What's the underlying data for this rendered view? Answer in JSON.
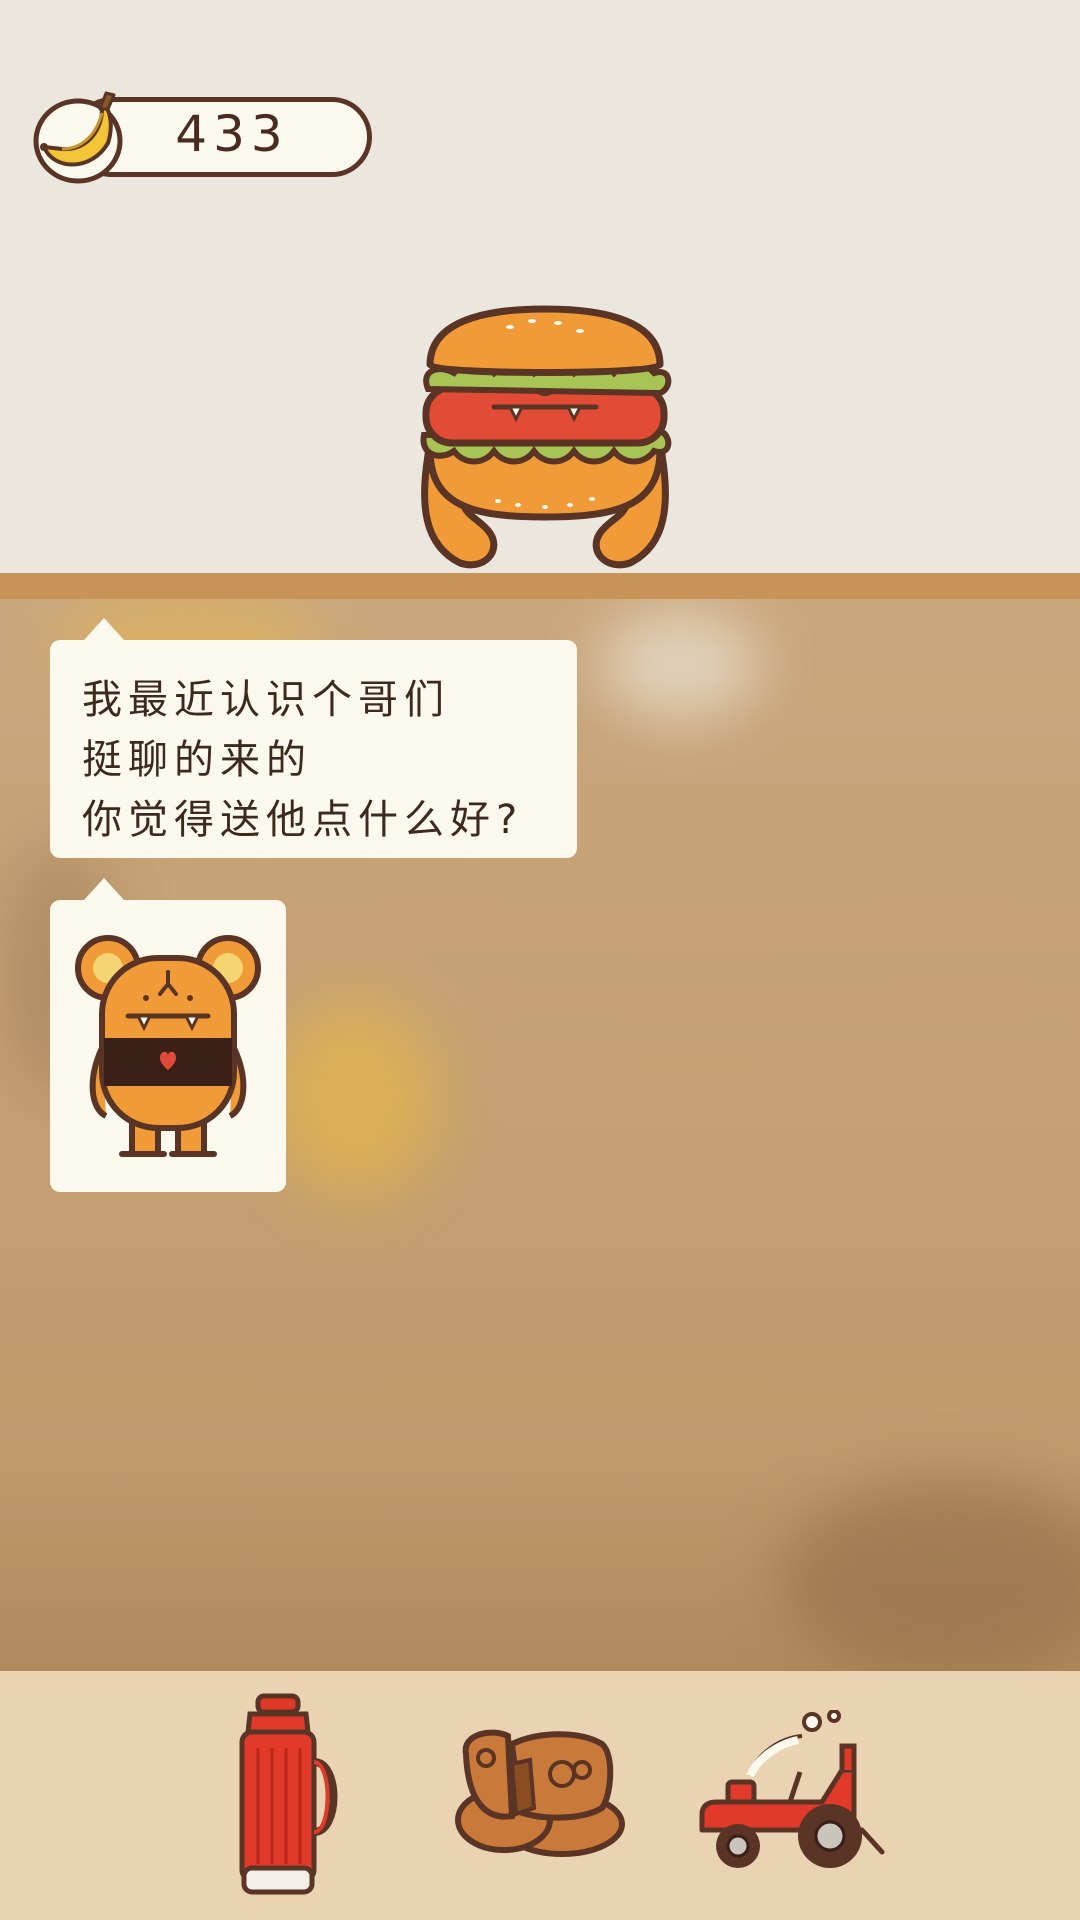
{
  "hud": {
    "banana_count": "433",
    "banana_icon": "banana-icon"
  },
  "character": {
    "icon": "burger-monster-icon"
  },
  "dialog": {
    "lines": [
      "我最近认识个哥们",
      "挺聊的来的",
      "你觉得送他点什么好?"
    ],
    "image_icon": "orange-bear-monster-icon"
  },
  "gift_options": [
    {
      "icon": "thermos-flask-icon"
    },
    {
      "icon": "mooncakes-icon"
    },
    {
      "icon": "red-tractor-icon"
    }
  ],
  "colors": {
    "background": "#ebe7df",
    "shelf": "#c89357",
    "scene": "#c4a073",
    "bubble": "#fbf8ee",
    "bottom_bar": "#ead3b2",
    "outline": "#5a3424"
  }
}
